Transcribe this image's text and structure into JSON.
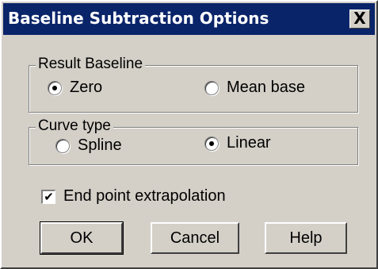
{
  "window": {
    "title": "Baseline Subtraction Options",
    "close_glyph": "X"
  },
  "result_baseline": {
    "legend": "Result Baseline",
    "options": [
      {
        "label": "Zero",
        "checked": true
      },
      {
        "label": "Mean base",
        "checked": false
      }
    ]
  },
  "curve_type": {
    "legend": "Curve type",
    "options": [
      {
        "label": "Spline",
        "checked": false
      },
      {
        "label": "Linear",
        "checked": true
      }
    ]
  },
  "extrapolation": {
    "label": "End point extrapolation",
    "checked": true,
    "check_glyph": "✔"
  },
  "buttons": {
    "ok": "OK",
    "cancel": "Cancel",
    "help": "Help"
  },
  "colors": {
    "title_bar": "#0a246a",
    "face": "#d4d0c8"
  }
}
